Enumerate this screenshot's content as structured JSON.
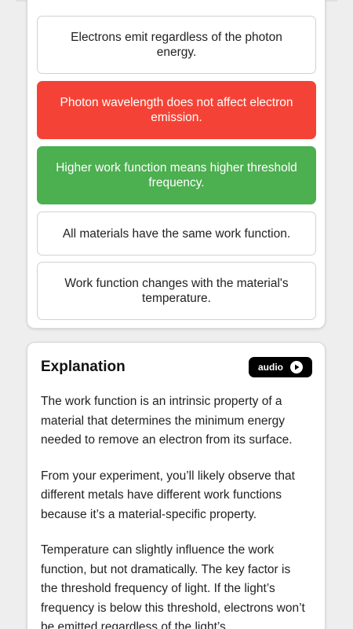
{
  "quiz": {
    "options": [
      {
        "label": "Electrons emit regardless of the photon energy.",
        "state": "neutral"
      },
      {
        "label": "Photon wavelength does not affect electron emission.",
        "state": "wrong"
      },
      {
        "label": "Higher work function means higher threshold frequency.",
        "state": "correct"
      },
      {
        "label": "All materials have the same work function.",
        "state": "neutral"
      },
      {
        "label": "Work function changes with the material's temperature.",
        "state": "neutral"
      }
    ]
  },
  "explanation": {
    "title": "Explanation",
    "audio_label": "audio",
    "audio_icon": "play-circle-icon",
    "paragraphs": [
      "The work function is an intrinsic property of a material that determines the minimum energy needed to remove an electron from its surface.",
      "From your experiment, you’ll likely observe that different metals have different work functions because it’s a material-specific property.",
      "Temperature can slightly influence the work function, but not dramatically. The key factor is the threshold frequency of light. If the light’s frequency is below this threshold, electrons won’t be emitted regardless of the light’s"
    ]
  },
  "colors": {
    "wrong": "#f44336",
    "correct": "#4caf50",
    "background": "#eeeeee",
    "card": "#ffffff",
    "audio_button": "#000000"
  }
}
